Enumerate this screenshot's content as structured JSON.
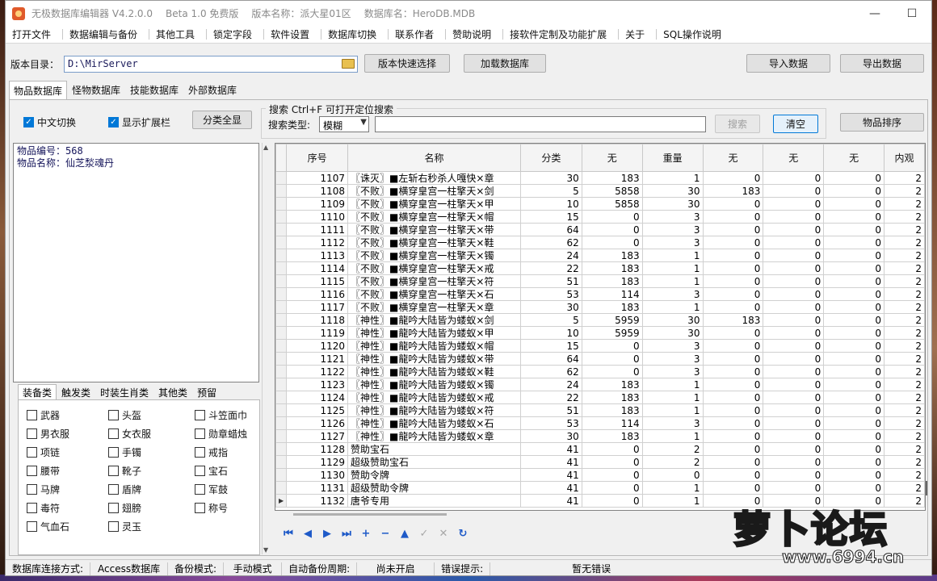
{
  "window": {
    "title_parts": [
      "无极数据库编辑器 V4.2.0.0",
      "Beta 1.0 免费版",
      "版本名称：派大星01区",
      "数据库名：HeroDB.MDB"
    ],
    "controls": {
      "minimize": "—",
      "maximize": "☐",
      "close": "✕"
    }
  },
  "menu": [
    "打开文件",
    "数据编辑与备份",
    "其他工具",
    "锁定字段",
    "软件设置",
    "数据库切换",
    "联系作者",
    "赞助说明",
    "接软件定制及功能扩展",
    "关于",
    "SQL操作说明"
  ],
  "toolbar": {
    "dir_label": "版本目录：",
    "dir_value": "D:\\MirServer",
    "quick_select": "版本快速选择",
    "load_db": "加载数据库",
    "import": "导入数据",
    "export": "导出数据"
  },
  "tabs": [
    "物品数据库",
    "怪物数据库",
    "技能数据库",
    "外部数据库"
  ],
  "options": {
    "chinese_switch": "中文切换",
    "show_ext": "显示扩展栏",
    "show_all": "分类全显"
  },
  "search": {
    "legend": "搜索   Ctrl+F 可打开定位搜索",
    "type_label": "搜索类型:",
    "type_value": "模糊",
    "search_btn": "搜索",
    "clear_btn": "清空",
    "sort_btn": "物品排序"
  },
  "info": {
    "line1": "物品编号：568",
    "line2": "物品名称：仙芝湬魂丹"
  },
  "category_tabs": [
    "装备类",
    "触发类",
    "时装生肖类",
    "其他类",
    "预留"
  ],
  "categories": [
    [
      "武器",
      "头盔",
      "斗笠面巾"
    ],
    [
      "男衣服",
      "女衣服",
      "勋章蜡烛"
    ],
    [
      "项链",
      "手镯",
      "戒指"
    ],
    [
      "腰带",
      "靴子",
      "宝石"
    ],
    [
      "马牌",
      "盾牌",
      "军鼓"
    ],
    [
      "毒符",
      "翅膀",
      "称号"
    ],
    [
      "气血石",
      "灵玉",
      ""
    ]
  ],
  "grid": {
    "headers": [
      "序号",
      "名称",
      "分类",
      "无",
      "重量",
      "无",
      "无",
      "无",
      "内观"
    ],
    "rows": [
      [
        "1107",
        "〖诛灭〗■左斩右秒杀人嘎快×章",
        "30",
        "183",
        "1",
        "0",
        "0",
        "0",
        "2"
      ],
      [
        "1108",
        "〖不败〗■横穿皇宫一柱擎天×剑",
        "5",
        "5858",
        "30",
        "183",
        "0",
        "0",
        "2"
      ],
      [
        "1109",
        "〖不败〗■横穿皇宫一柱擎天×甲",
        "10",
        "5858",
        "30",
        "0",
        "0",
        "0",
        "2"
      ],
      [
        "1110",
        "〖不败〗■横穿皇宫一柱擎天×帽",
        "15",
        "0",
        "3",
        "0",
        "0",
        "0",
        "2"
      ],
      [
        "1111",
        "〖不败〗■横穿皇宫一柱擎天×带",
        "64",
        "0",
        "3",
        "0",
        "0",
        "0",
        "2"
      ],
      [
        "1112",
        "〖不败〗■横穿皇宫一柱擎天×鞋",
        "62",
        "0",
        "3",
        "0",
        "0",
        "0",
        "2"
      ],
      [
        "1113",
        "〖不败〗■横穿皇宫一柱擎天×镯",
        "24",
        "183",
        "1",
        "0",
        "0",
        "0",
        "2"
      ],
      [
        "1114",
        "〖不败〗■横穿皇宫一柱擎天×戒",
        "22",
        "183",
        "1",
        "0",
        "0",
        "0",
        "2"
      ],
      [
        "1115",
        "〖不败〗■横穿皇宫一柱擎天×符",
        "51",
        "183",
        "1",
        "0",
        "0",
        "0",
        "2"
      ],
      [
        "1116",
        "〖不败〗■横穿皇宫一柱擎天×石",
        "53",
        "114",
        "3",
        "0",
        "0",
        "0",
        "2"
      ],
      [
        "1117",
        "〖不败〗■横穿皇宫一柱擎天×章",
        "30",
        "183",
        "1",
        "0",
        "0",
        "0",
        "2"
      ],
      [
        "1118",
        "〖神性〗■龍吟大陆皆为蝼蚁×剑",
        "5",
        "5959",
        "30",
        "183",
        "0",
        "0",
        "2"
      ],
      [
        "1119",
        "〖神性〗■龍吟大陆皆为蝼蚁×甲",
        "10",
        "5959",
        "30",
        "0",
        "0",
        "0",
        "2"
      ],
      [
        "1120",
        "〖神性〗■龍吟大陆皆为蝼蚁×帽",
        "15",
        "0",
        "3",
        "0",
        "0",
        "0",
        "2"
      ],
      [
        "1121",
        "〖神性〗■龍吟大陆皆为蝼蚁×带",
        "64",
        "0",
        "3",
        "0",
        "0",
        "0",
        "2"
      ],
      [
        "1122",
        "〖神性〗■龍吟大陆皆为蝼蚁×鞋",
        "62",
        "0",
        "3",
        "0",
        "0",
        "0",
        "2"
      ],
      [
        "1123",
        "〖神性〗■龍吟大陆皆为蝼蚁×镯",
        "24",
        "183",
        "1",
        "0",
        "0",
        "0",
        "2"
      ],
      [
        "1124",
        "〖神性〗■龍吟大陆皆为蝼蚁×戒",
        "22",
        "183",
        "1",
        "0",
        "0",
        "0",
        "2"
      ],
      [
        "1125",
        "〖神性〗■龍吟大陆皆为蝼蚁×符",
        "51",
        "183",
        "1",
        "0",
        "0",
        "0",
        "2"
      ],
      [
        "1126",
        "〖神性〗■龍吟大陆皆为蝼蚁×石",
        "53",
        "114",
        "3",
        "0",
        "0",
        "0",
        "2"
      ],
      [
        "1127",
        "〖神性〗■龍吟大陆皆为蝼蚁×章",
        "30",
        "183",
        "1",
        "0",
        "0",
        "0",
        "2"
      ],
      [
        "1128",
        "赞助宝石",
        "41",
        "0",
        "2",
        "0",
        "0",
        "0",
        "2"
      ],
      [
        "1129",
        "超级赞助宝石",
        "41",
        "0",
        "2",
        "0",
        "0",
        "0",
        "2"
      ],
      [
        "1130",
        "赞助令牌",
        "41",
        "0",
        "0",
        "0",
        "0",
        "0",
        "2"
      ],
      [
        "1131",
        "超级赞助令牌",
        "41",
        "0",
        "1",
        "0",
        "0",
        "0",
        "2"
      ],
      [
        "1132",
        "唐爷专用",
        "41",
        "0",
        "1",
        "0",
        "0",
        "0",
        "2"
      ]
    ],
    "current_row_marker": "▶"
  },
  "status": {
    "conn_label": "数据库连接方式:",
    "conn_value": "Access数据库",
    "backup_label": "备份模式:",
    "backup_value": "手动模式",
    "auto_label": "自动备份周期:",
    "auto_value": "尚未开启",
    "error_label": "错误提示:",
    "error_value": "暂无错误"
  },
  "watermark": {
    "brand": "萝卜论坛",
    "url": "www.6994.cn"
  }
}
